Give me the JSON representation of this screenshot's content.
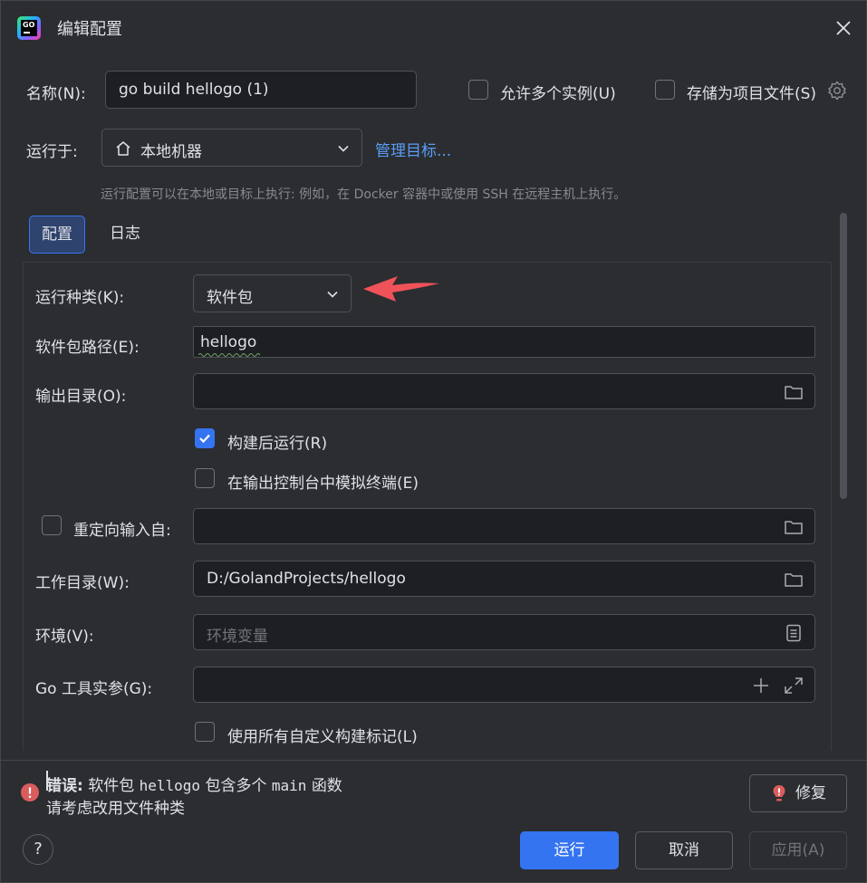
{
  "window": {
    "title": "编辑配置",
    "app_logo": "GO"
  },
  "header": {
    "name_label": "名称(N):",
    "name_value": "go build hellogo (1)",
    "allow_multiple_label": "允许多个实例(U)",
    "store_as_file_label": "存储为项目文件(S)",
    "run_on_label": "运行于:",
    "run_on_value": "本地机器",
    "manage_targets_link": "管理目标...",
    "run_on_hint": "运行配置可以在本地或目标上执行: 例如，在 Docker 容器中或使用 SSH 在远程主机上执行。"
  },
  "tabs": [
    {
      "label": "配置",
      "active": true
    },
    {
      "label": "日志",
      "active": false
    }
  ],
  "form": {
    "run_kind_label": "运行种类(K):",
    "run_kind_value": "软件包",
    "package_path_label": "软件包路径(E):",
    "package_path_value": "hellogo",
    "output_dir_label": "输出目录(O):",
    "output_dir_value": "",
    "run_after_build_label": "构建后运行(R)",
    "run_after_build_checked": true,
    "emulate_terminal_label": "在输出控制台中模拟终端(E)",
    "emulate_terminal_checked": false,
    "redirect_input_label": "重定向输入自:",
    "redirect_input_checked": false,
    "redirect_input_value": "",
    "working_dir_label": "工作目录(W):",
    "working_dir_value": "D:/GolandProjects/hellogo",
    "env_label": "环境(V):",
    "env_placeholder": "环境变量",
    "go_tool_args_label": "Go 工具实参(G):",
    "go_tool_args_value": "",
    "use_custom_tags_label": "使用所有自定义构建标记(L)",
    "use_custom_tags_checked": false
  },
  "error": {
    "prefix": "错误:",
    "msg_a": "软件包",
    "pkg": "hellogo",
    "msg_b": "包含多个",
    "fn": "main",
    "msg_c": "函数",
    "line2": "请考虑改用文件种类",
    "fix_button": "修复"
  },
  "footer": {
    "help": "?",
    "run": "运行",
    "cancel": "取消",
    "apply": "应用(A)"
  },
  "colors": {
    "accent": "#3574f0",
    "error": "#db5c5c",
    "link": "#589df6",
    "annotation_arrow": "#f0525a"
  }
}
